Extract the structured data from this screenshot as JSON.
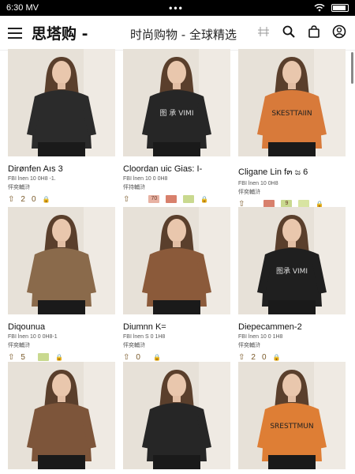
{
  "status": {
    "time": "6:30 MV",
    "dots": "•••"
  },
  "header": {
    "title": "思塔购 -",
    "subtitle": "时尚购物 - 全球精选"
  },
  "products": [
    {
      "name": "Dirønfen Aıs 3",
      "meta1": "FBI lnen 10 0H8 -1.",
      "meta2": "怦奕輔浒",
      "a1": "2",
      "a2": "0",
      "img_color": "#2a2a2a",
      "shirt": "#2b2b2b",
      "print": "",
      "badges": []
    },
    {
      "name": "Cloordan uic Gias: I-",
      "meta1": "FBI lnen 10 0 0H8",
      "meta2": "怦持輔浒",
      "a1": "",
      "a2": "",
      "img_color": "#222",
      "shirt": "#262626",
      "print": "图 承 VIMI",
      "badges": [
        "70",
        "",
        ""
      ]
    },
    {
      "name": "Cligane Lin f๓ ಜ 6",
      "meta1": "FBI lnen 10 0H8",
      "meta2": "怦奕輔浒",
      "a1": "",
      "a2": "",
      "img_color": "#d9803f",
      "shirt": "#d87a3a",
      "print": "SKESTTAIIN",
      "badges": [
        "",
        "9",
        ""
      ]
    },
    {
      "name": "Diqounua",
      "meta1": "FBI lnen 10 0 0H8-1",
      "meta2": "怦奕輔浒",
      "a1": "5",
      "a2": "",
      "img_color": "#8a6b4a",
      "shirt": "#8a6a4b",
      "print": "",
      "badges": [
        ""
      ]
    },
    {
      "name": "Diumnn K=",
      "meta1": "FBI lnen S 0 1H8",
      "meta2": "怦奕輔浒",
      "a1": "0",
      "a2": "",
      "img_color": "#8a5c3d",
      "shirt": "#8b5a3a",
      "print": "",
      "badges": []
    },
    {
      "name": "Diepecammen-2",
      "meta1": "FBI lnen 10 0 1H8",
      "meta2": "怦奕輔浒",
      "a1": "2",
      "a2": "0",
      "img_color": "#1e1e1e",
      "shirt": "#1f1f1f",
      "print": "图承 VIMI",
      "badges": []
    },
    {
      "name": "",
      "meta1": "",
      "meta2": "",
      "a1": "",
      "a2": "",
      "img_color": "#7e553a",
      "shirt": "#7d553a",
      "print": "",
      "badges": []
    },
    {
      "name": "",
      "meta1": "",
      "meta2": "",
      "a1": "",
      "a2": "",
      "img_color": "#262626",
      "shirt": "#262626",
      "print": "",
      "badges": []
    },
    {
      "name": "",
      "meta1": "",
      "meta2": "",
      "a1": "",
      "a2": "",
      "img_color": "#de7e35",
      "shirt": "#de7e35",
      "print": "SRESTTMUN",
      "badges": []
    }
  ],
  "icons": {
    "menu": "menu-icon",
    "tag": "tag-icon",
    "search": "search-icon",
    "bag": "bag-icon",
    "user": "user-icon",
    "wifi": "wifi-icon",
    "battery": "battery-icon"
  }
}
